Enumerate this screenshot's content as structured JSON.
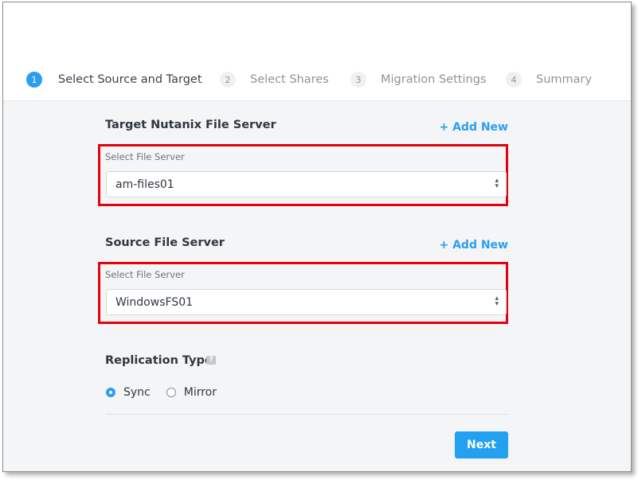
{
  "wizard": {
    "steps": [
      {
        "number": "1",
        "label": "Select Source and Target"
      },
      {
        "number": "2",
        "label": "Select Shares"
      },
      {
        "number": "3",
        "label": "Migration Settings"
      },
      {
        "number": "4",
        "label": "Summary"
      }
    ],
    "active_step": 1
  },
  "target": {
    "title": "Target Nutanix File Server",
    "add_new": "+ Add New",
    "field_label": "Select File Server",
    "selected": "am-files01"
  },
  "source": {
    "title": "Source File Server",
    "add_new": "+ Add New",
    "field_label": "Select File Server",
    "selected": "WindowsFS01"
  },
  "replication": {
    "title": "Replication Type",
    "help_icon": "?",
    "options": [
      {
        "label": "Sync",
        "checked": true
      },
      {
        "label": "Mirror",
        "checked": false
      }
    ]
  },
  "actions": {
    "next_label": "Next"
  },
  "colors": {
    "accent": "#2b9ef0",
    "highlight": "#e3000f"
  }
}
